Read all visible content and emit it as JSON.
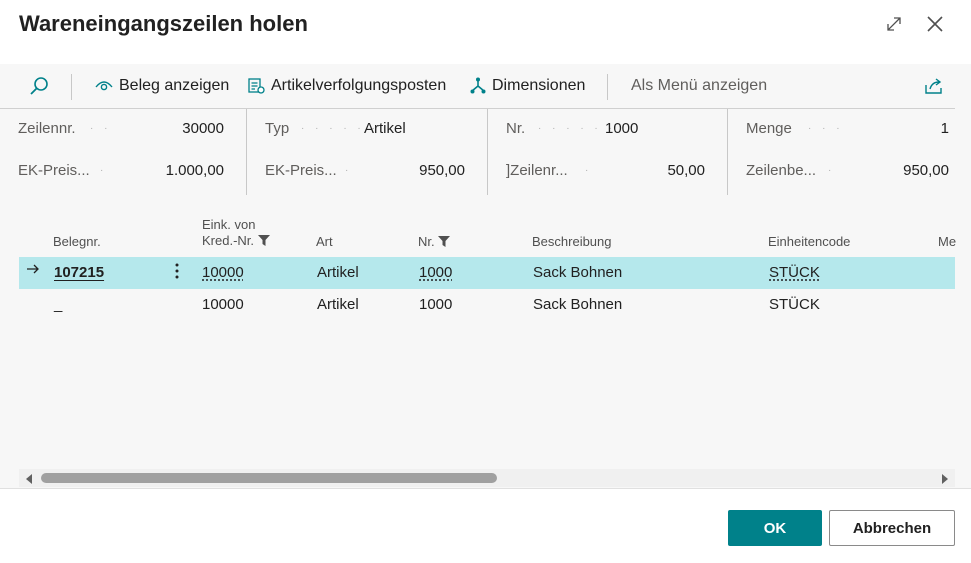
{
  "dialog": {
    "title": "Wareneingangszeilen holen"
  },
  "toolbar": {
    "search_icon": "search-icon",
    "show_document_label": "Beleg anzeigen",
    "item_tracking_label": "Artikelverfolgungsposten",
    "dimensions_label": "Dimensionen",
    "show_as_menu_label": "Als Menü anzeigen"
  },
  "factbox": {
    "col1": {
      "r1_label": "Zeilennr.",
      "r1_value": "30000",
      "r2_label": "EK-Preis...",
      "r2_value": "1.000,00"
    },
    "col2": {
      "r1_label": "Typ",
      "r1_value": "Artikel",
      "r2_label": "EK-Preis...",
      "r2_value": "950,00"
    },
    "col3": {
      "r1_label": "Nr.",
      "r1_value": "1000",
      "r2_label": "]Zeilenr...",
      "r2_value": "50,00"
    },
    "col4": {
      "r1_label": "Menge",
      "r1_value": "1",
      "r2_label": "Zeilenbe...",
      "r2_value": "950,00"
    }
  },
  "grid": {
    "headers": {
      "doc_no": "Belegnr.",
      "vendor_l1": "Eink. von",
      "vendor_l2": "Kred.-Nr.",
      "type": "Art",
      "no": "Nr.",
      "description": "Beschreibung",
      "unit": "Einheitencode",
      "qty_partial": "Me"
    },
    "rows": [
      {
        "doc_no": "107215",
        "vendor": "10000",
        "type": "Artikel",
        "no": "1000",
        "description": "Sack Bohnen",
        "unit": "STÜCK"
      },
      {
        "doc_no": "_",
        "vendor": "10000",
        "type": "Artikel",
        "no": "1000",
        "description": "Sack Bohnen",
        "unit": "STÜCK"
      }
    ]
  },
  "footer": {
    "ok_label": "OK",
    "cancel_label": "Abbrechen"
  },
  "colors": {
    "accent": "#00818a",
    "selected_row": "#b5e8ec"
  }
}
